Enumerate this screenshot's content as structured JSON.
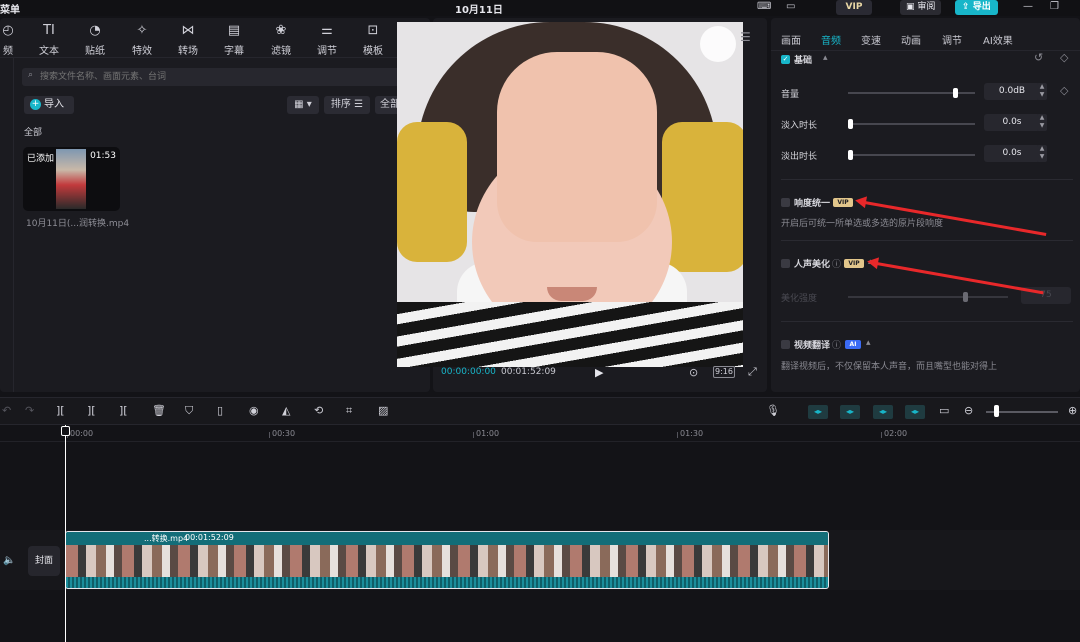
{
  "topbar": {
    "menu": "菜单",
    "title": "10月11日",
    "vip": "VIP",
    "review": "审阅",
    "export": "导出"
  },
  "left": {
    "tools": [
      {
        "label": "频",
        "icon": "media-icon"
      },
      {
        "label": "文本",
        "icon": "text-icon"
      },
      {
        "label": "贴纸",
        "icon": "sticker-icon"
      },
      {
        "label": "特效",
        "icon": "effects-icon"
      },
      {
        "label": "转场",
        "icon": "transition-icon"
      },
      {
        "label": "字幕",
        "icon": "subtitle-icon"
      },
      {
        "label": "滤镜",
        "icon": "filter-icon"
      },
      {
        "label": "调节",
        "icon": "adjust-icon"
      },
      {
        "label": "模板",
        "icon": "template-icon"
      }
    ],
    "search_placeholder": "搜索文件名称、画面元素、台词",
    "import": "导入",
    "sort": "排序",
    "all_filter": "全部",
    "section": "全部",
    "media": {
      "added": "已添加",
      "duration": "01:53",
      "name": "10月11日(...润转换.mp4"
    }
  },
  "preview": {
    "time_current": "00:00:00:00",
    "time_total": "00:01:52:09",
    "ratio": "9:16"
  },
  "right": {
    "tabs": [
      "画面",
      "音频",
      "变速",
      "动画",
      "调节",
      "AI效果"
    ],
    "active_tab": "音频",
    "basic": "基础",
    "volume_label": "音量",
    "volume_value": "0.0dB",
    "volume_level": 0.83,
    "fadein_label": "淡入时长",
    "fadein_value": "0.0s",
    "fadeout_label": "淡出时长",
    "fadeout_value": "0.0s",
    "loudness_title": "响度统一",
    "loudness_desc": "开启后可统一所单选或多选的原片段响度",
    "voice_title": "人声美化",
    "beautify_label": "美化强度",
    "beautify_value": "75",
    "translate_title": "视频翻译",
    "translate_desc": "翻译视频后，不仅保留本人声音，而且嘴型也能对得上",
    "vip_tag": "VIP",
    "ai_tag": "AI",
    "accent": "#18b6c9",
    "annotation_color": "#e8282a"
  },
  "timeline": {
    "ruler": [
      "00:00",
      "00:30",
      "01:00",
      "01:30",
      "02:00"
    ],
    "cover": "封面",
    "clip_name": "...转换.mp4",
    "clip_duration": "00:01:52:09"
  }
}
